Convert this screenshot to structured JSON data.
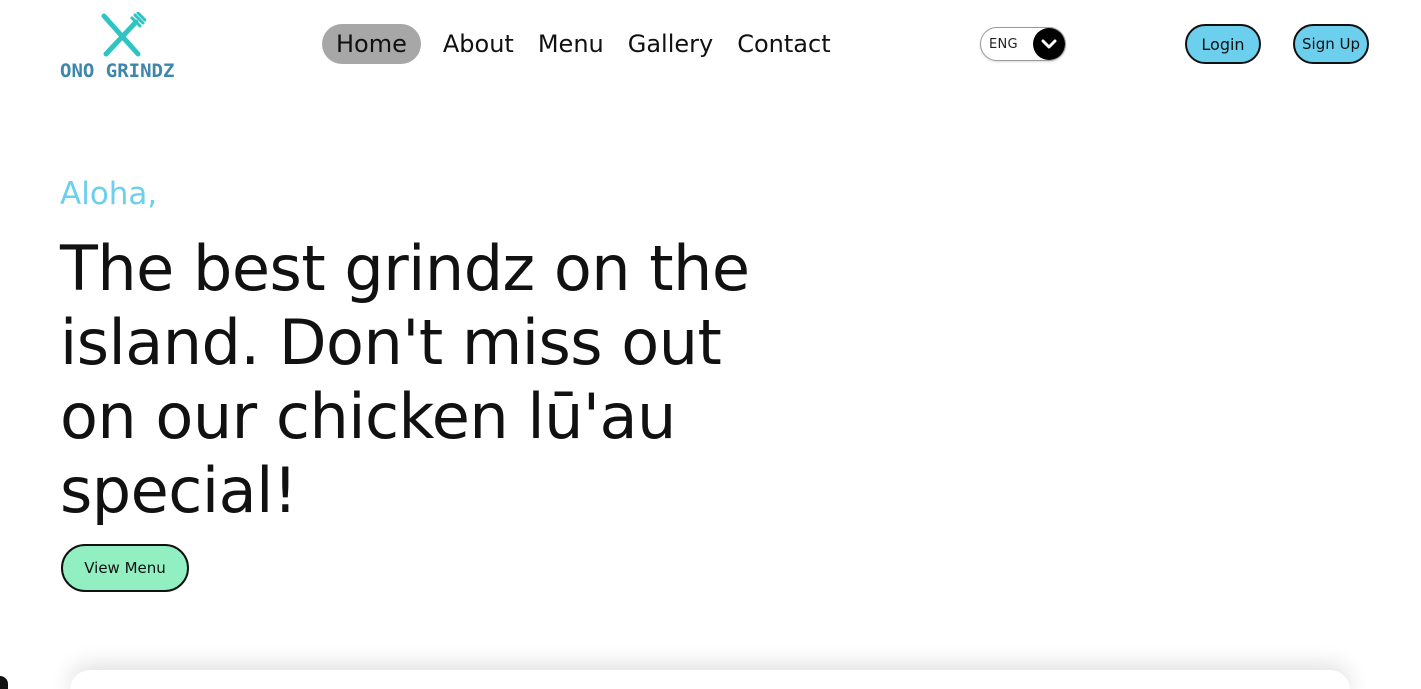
{
  "brand": {
    "name": "ONO GRINDZ",
    "logo_icon": "fork-knife-icon",
    "accent_color": "#2ec4c4",
    "text_color": "#3f86ab"
  },
  "nav": {
    "items": [
      {
        "label": "Home",
        "active": true
      },
      {
        "label": "About",
        "active": false
      },
      {
        "label": "Menu",
        "active": false
      },
      {
        "label": "Gallery",
        "active": false
      },
      {
        "label": "Contact",
        "active": false
      }
    ],
    "active_bg": "#a8a7a7"
  },
  "language": {
    "selected": "ENG",
    "icon": "chevron-down-icon"
  },
  "auth": {
    "login_label": "Login",
    "signup_label": "Sign Up",
    "button_color": "#6dcfee"
  },
  "hero": {
    "greeting": "Aloha,",
    "headline": "The best grindz on the island. Don't miss out on our chicken lū'au special!",
    "cta_label": "View Menu",
    "greeting_color": "#6dcfee",
    "cta_color": "#91efc1"
  }
}
